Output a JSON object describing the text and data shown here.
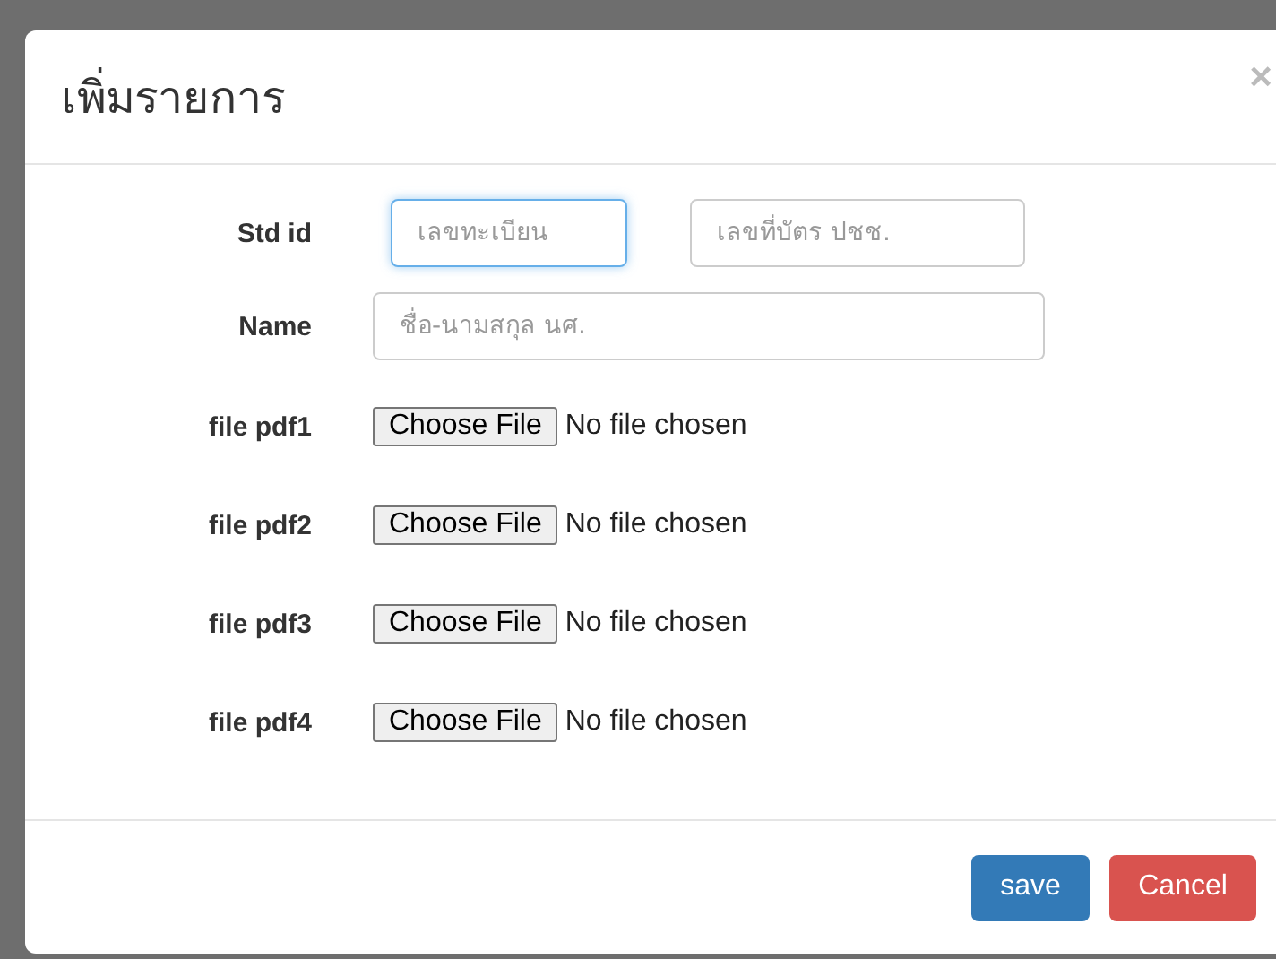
{
  "dialog": {
    "title": "เพิ่มรายการ",
    "close": "×"
  },
  "fields": [
    {
      "label": "Std id",
      "inputs": [
        {
          "placeholder": "เลขทะเบียน",
          "focused": true
        },
        {
          "placeholder": "เลขที่บัตร ปชช.",
          "focused": false
        }
      ]
    },
    {
      "label": "Name",
      "inputs": [
        {
          "placeholder": "ชื่อ-นามสกุล นศ.",
          "focused": false
        }
      ]
    }
  ],
  "files": [
    {
      "label": "file pdf1",
      "button": "Choose File",
      "status": "No file chosen"
    },
    {
      "label": "file pdf2",
      "button": "Choose File",
      "status": "No file chosen"
    },
    {
      "label": "file pdf3",
      "button": "Choose File",
      "status": "No file chosen"
    },
    {
      "label": "file pdf4",
      "button": "Choose File",
      "status": "No file chosen"
    }
  ],
  "buttons": [
    {
      "label": "save",
      "kind": "primary"
    },
    {
      "label": "Cancel",
      "kind": "danger"
    }
  ]
}
